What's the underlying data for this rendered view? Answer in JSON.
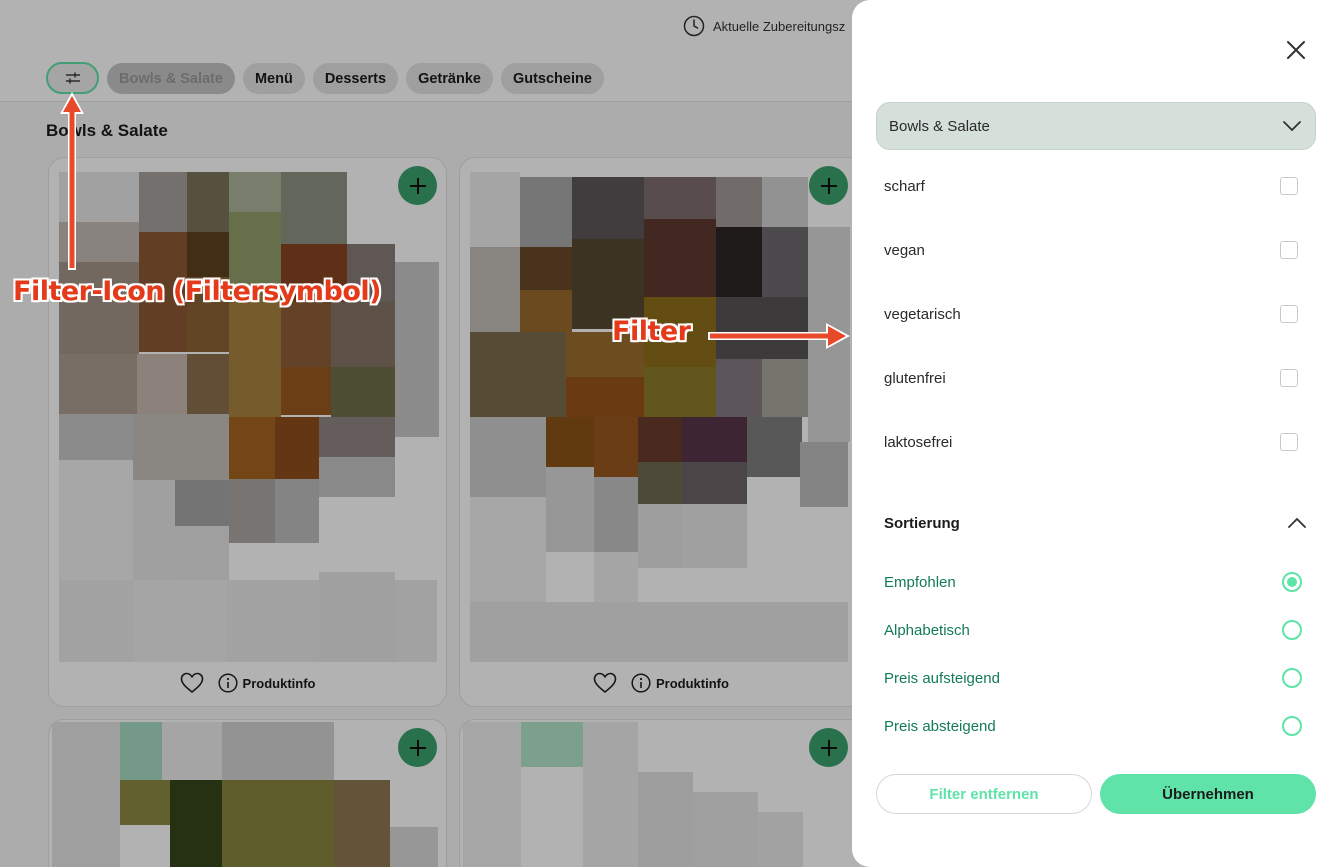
{
  "header": {
    "prep_time_label": "Aktuelle Zubereitungsz",
    "categories": [
      {
        "label": "Bowls & Salate",
        "active": true
      },
      {
        "label": "Menü",
        "active": false
      },
      {
        "label": "Desserts",
        "active": false
      },
      {
        "label": "Getränke",
        "active": false
      },
      {
        "label": "Gutscheine",
        "active": false
      }
    ]
  },
  "section": {
    "title": "Bowls & Salate"
  },
  "products": [
    {
      "info_label": "Produktinfo"
    },
    {
      "info_label": "Produktinfo"
    },
    {},
    {}
  ],
  "annotations": {
    "filter_icon": "Filter-Icon (Filtersymbol)",
    "filter": "Filter"
  },
  "drawer": {
    "select_value": "Bowls & Salate",
    "filters": [
      {
        "label": "scharf",
        "checked": false
      },
      {
        "label": "vegan",
        "checked": false
      },
      {
        "label": "vegetarisch",
        "checked": false
      },
      {
        "label": "glutenfrei",
        "checked": false
      },
      {
        "label": "laktosefrei",
        "checked": false
      }
    ],
    "sort_title": "Sortierung",
    "sort_options": [
      {
        "label": "Empfohlen",
        "selected": true
      },
      {
        "label": "Alphabetisch",
        "selected": false
      },
      {
        "label": "Preis aufsteigend",
        "selected": false
      },
      {
        "label": "Preis absteigend",
        "selected": false
      }
    ],
    "remove_label": "Filter entfernen",
    "apply_label": "Übernehmen"
  },
  "colors": {
    "accent": "#5fe3a8",
    "accent_dark": "#137a5a",
    "add_button": "#3aa36e",
    "annotation": "#e43a1a",
    "select_bg": "#d4e0d9"
  },
  "icons": [
    "clock-icon",
    "sliders-icon",
    "plus-icon",
    "heart-icon",
    "info-icon",
    "close-icon",
    "chevron-down-icon",
    "chevron-up-icon"
  ]
}
